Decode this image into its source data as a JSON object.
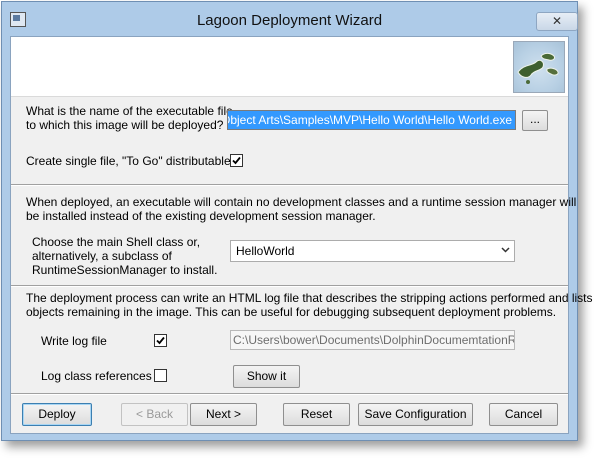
{
  "window": {
    "title": "Lagoon Deployment Wizard",
    "close_glyph": "✕",
    "app_icon": "application-icon",
    "banner_image": "lagoon-islands-logo"
  },
  "executable": {
    "question_line1": "What is the name of the executable file",
    "question_line2": "to which this image will be deployed?",
    "path_value": "re\\Object Arts\\Samples\\MVP\\Hello World\\Hello World.exe",
    "browse_label": "...",
    "single_file_label": "Create single file, \"To Go\" distributable.",
    "single_file_checked": true
  },
  "shell": {
    "info_line1": "When deployed, an executable will contain no development classes and a runtime session manager will",
    "info_line2": "be installed instead of the existing development session manager.",
    "choose_line1": "Choose the main Shell class or,",
    "choose_line2": "alternatively, a subclass of",
    "choose_line3": "RuntimeSessionManager to install.",
    "selected_class": "HelloWorld"
  },
  "log": {
    "info_line1": "The deployment process can write an HTML log file that describes the stripping actions performed and lists",
    "info_line2": "objects remaining in the image. This can be useful for debugging subsequent deployment problems.",
    "write_log_label": "Write log file",
    "write_log_checked": true,
    "log_path": "C:\\Users\\bower\\Documents\\DolphinDocumemtationRefres",
    "class_refs_label": "Log class references",
    "class_refs_checked": false,
    "show_it_label": "Show it"
  },
  "buttons": {
    "deploy": "Deploy",
    "back": "< Back",
    "next": "Next >",
    "reset": "Reset",
    "save_config": "Save Configuration",
    "cancel": "Cancel"
  },
  "colors": {
    "selection": "#3399ff",
    "frame": "#aecbe8",
    "dialog": "#f0f0f0"
  }
}
